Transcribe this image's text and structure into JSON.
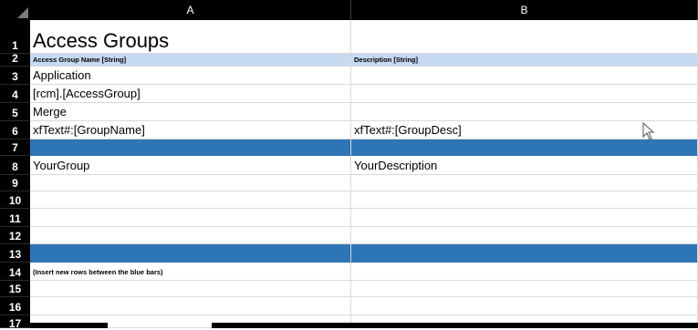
{
  "columns": [
    "A",
    "B"
  ],
  "rows": [
    {
      "num": "1",
      "a": "Access Groups",
      "b": ""
    },
    {
      "num": "2",
      "a": "Access Group Name [String]",
      "b": "Description [String]"
    },
    {
      "num": "3",
      "a": "Application",
      "b": ""
    },
    {
      "num": "4",
      "a": "[rcm].[AccessGroup]",
      "b": ""
    },
    {
      "num": "5",
      "a": "Merge",
      "b": ""
    },
    {
      "num": "6",
      "a": "xfText#:[GroupName]",
      "b": "xfText#:[GroupDesc]"
    },
    {
      "num": "7",
      "a": "",
      "b": ""
    },
    {
      "num": "8",
      "a": "YourGroup",
      "b": "YourDescription"
    },
    {
      "num": "9",
      "a": "",
      "b": ""
    },
    {
      "num": "10",
      "a": "",
      "b": ""
    },
    {
      "num": "11",
      "a": "",
      "b": ""
    },
    {
      "num": "12",
      "a": "",
      "b": ""
    },
    {
      "num": "13",
      "a": "",
      "b": ""
    },
    {
      "num": "14",
      "a": "(Insert new rows between the blue bars)",
      "b": ""
    },
    {
      "num": "15",
      "a": "",
      "b": ""
    },
    {
      "num": "16",
      "a": "",
      "b": ""
    },
    {
      "num": "17",
      "a": "",
      "b": ""
    }
  ],
  "colors": {
    "header_band": "#c5d9f1",
    "blue_bar": "#2e75b6",
    "frame": "#000000"
  },
  "icons": {
    "select_all": "select-all-triangle-icon",
    "pointer": "mouse-pointer-icon"
  }
}
